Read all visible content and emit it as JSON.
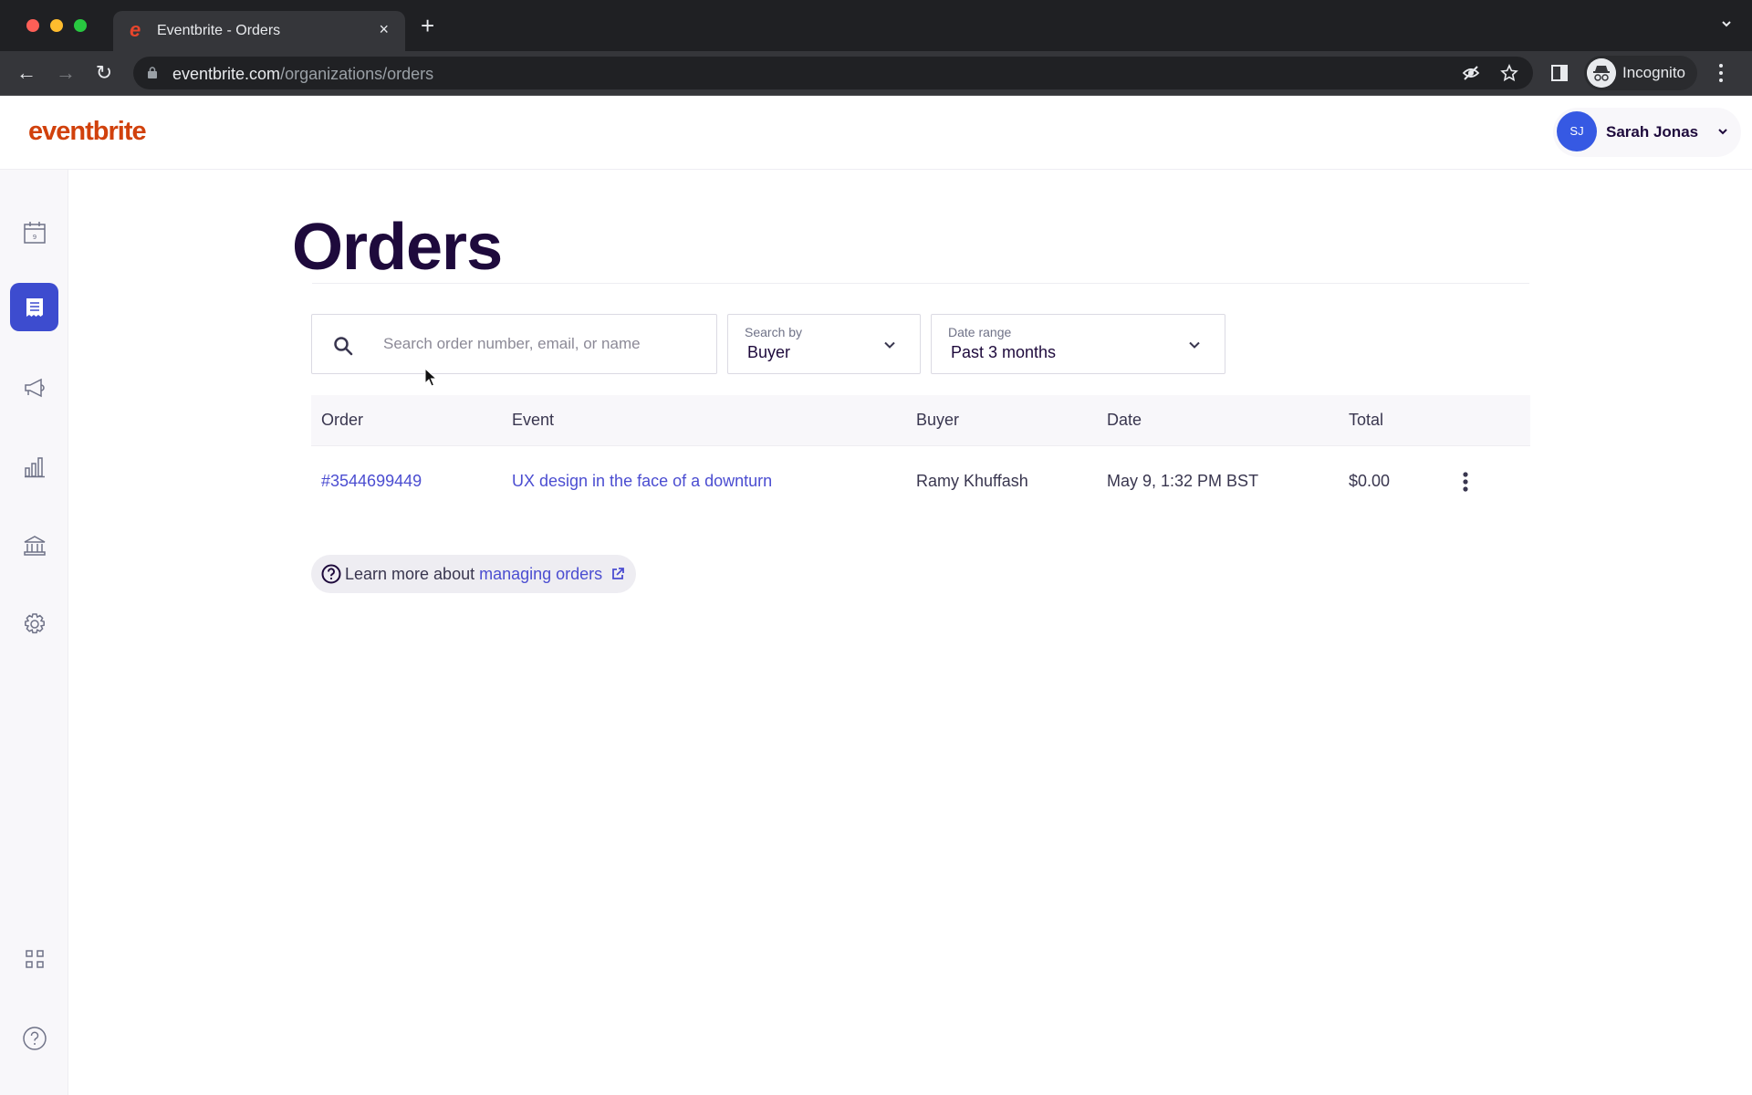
{
  "browser": {
    "tab_title": "Eventbrite - Orders",
    "tab_favicon": "e",
    "close_tab": "×",
    "new_tab": "+",
    "url_domain": "eventbrite.com",
    "url_path": "/organizations/orders",
    "profile_label": "Incognito"
  },
  "header": {
    "logo": "eventbrite",
    "user_initials": "SJ",
    "user_name": "Sarah Jonas"
  },
  "sidebar": {
    "items": [
      {
        "name": "events",
        "icon": "calendar-icon",
        "active": false
      },
      {
        "name": "orders",
        "icon": "receipt-icon",
        "active": true
      },
      {
        "name": "marketing",
        "icon": "megaphone-icon",
        "active": false
      },
      {
        "name": "reports",
        "icon": "bar-chart-icon",
        "active": false
      },
      {
        "name": "finance",
        "icon": "bank-icon",
        "active": false
      },
      {
        "name": "settings",
        "icon": "gear-icon",
        "active": false
      },
      {
        "name": "apps",
        "icon": "app-grid-icon",
        "active": false
      },
      {
        "name": "help",
        "icon": "help-icon",
        "active": false
      }
    ],
    "calendar_day": "9"
  },
  "main": {
    "title": "Orders",
    "search": {
      "placeholder": "Search order number, email, or name",
      "value": ""
    },
    "search_by": {
      "label": "Search by",
      "value": "Buyer"
    },
    "date_range": {
      "label": "Date range",
      "value": "Past 3 months"
    },
    "table": {
      "columns": [
        "Order",
        "Event",
        "Buyer",
        "Date",
        "Total"
      ],
      "rows": [
        {
          "order": "#3544699449",
          "event": "UX design in the face of a downturn",
          "buyer": "Ramy Khuffash",
          "date": "May 9, 1:32 PM BST",
          "total": "$0.00"
        }
      ]
    },
    "help": {
      "prefix": "Learn more about",
      "link": "managing orders"
    }
  },
  "colors": {
    "brand": "#d1410c",
    "accent": "#3d4ccf",
    "link": "#4b4dd1",
    "title": "#1e0a3c"
  }
}
